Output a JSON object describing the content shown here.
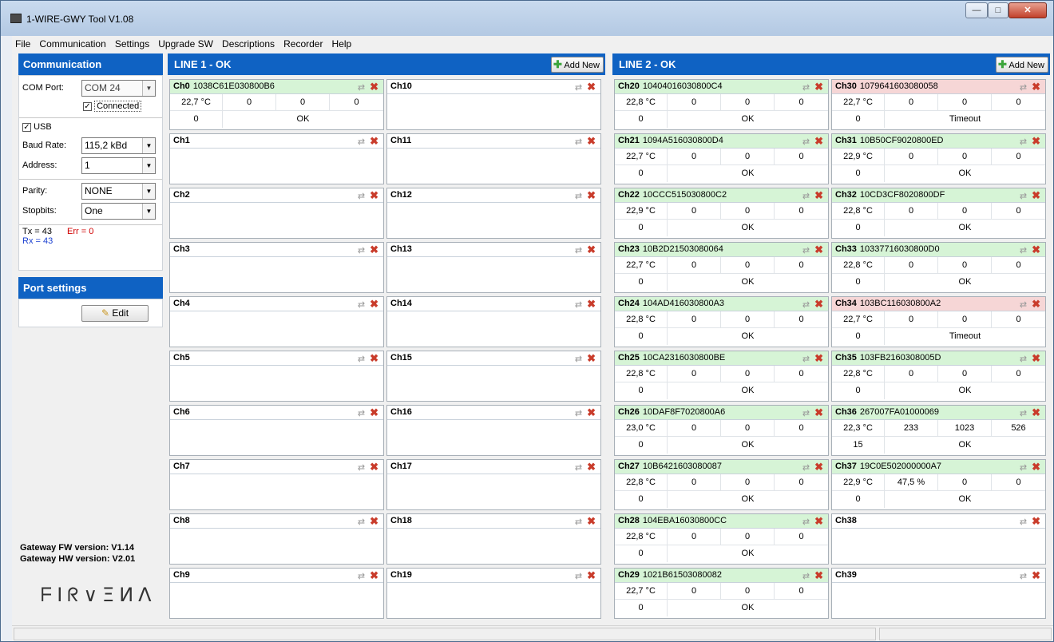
{
  "app": {
    "title": "1-WIRE-GWY Tool V1.08"
  },
  "menu": [
    "File",
    "Communication",
    "Settings",
    "Upgrade SW",
    "Descriptions",
    "Recorder",
    "Help"
  ],
  "communication": {
    "header": "Communication",
    "com_port_label": "COM Port:",
    "com_port_value": "COM 24",
    "connected_label": "Connected",
    "connected_checked": true,
    "usb_label": "USB",
    "usb_checked": true,
    "baud_label": "Baud Rate:",
    "baud_value": "115,2 kBd",
    "address_label": "Address:",
    "address_value": "1",
    "parity_label": "Parity:",
    "parity_value": "NONE",
    "stopbits_label": "Stopbits:",
    "stopbits_value": "One",
    "tx": "Tx = 43",
    "rx": "Rx = 43",
    "err": "Err = 0"
  },
  "port_settings": {
    "header": "Port settings",
    "edit_label": "Edit"
  },
  "gateway": {
    "fw": "Gateway FW version: V1.14",
    "hw": "Gateway HW version: V2.01"
  },
  "logo_text": "FIRVENA",
  "lines": [
    {
      "title": "LINE 1 - OK",
      "add_new": "Add New",
      "channels": [
        {
          "name": "Ch0",
          "addr": "1038C61E030800B6",
          "state": "ok",
          "temp": "22,7 °C",
          "v1": "0",
          "v2": "0",
          "v3": "0",
          "v4": "0",
          "status": "OK"
        },
        {
          "name": "Ch1",
          "addr": "",
          "state": "empty"
        },
        {
          "name": "Ch2",
          "addr": "",
          "state": "empty"
        },
        {
          "name": "Ch3",
          "addr": "",
          "state": "empty"
        },
        {
          "name": "Ch4",
          "addr": "",
          "state": "empty"
        },
        {
          "name": "Ch5",
          "addr": "",
          "state": "empty"
        },
        {
          "name": "Ch6",
          "addr": "",
          "state": "empty"
        },
        {
          "name": "Ch7",
          "addr": "",
          "state": "empty"
        },
        {
          "name": "Ch8",
          "addr": "",
          "state": "empty"
        },
        {
          "name": "Ch9",
          "addr": "",
          "state": "empty"
        },
        {
          "name": "Ch10",
          "addr": "",
          "state": "empty"
        },
        {
          "name": "Ch11",
          "addr": "",
          "state": "empty"
        },
        {
          "name": "Ch12",
          "addr": "",
          "state": "empty"
        },
        {
          "name": "Ch13",
          "addr": "",
          "state": "empty"
        },
        {
          "name": "Ch14",
          "addr": "",
          "state": "empty"
        },
        {
          "name": "Ch15",
          "addr": "",
          "state": "empty"
        },
        {
          "name": "Ch16",
          "addr": "",
          "state": "empty"
        },
        {
          "name": "Ch17",
          "addr": "",
          "state": "empty"
        },
        {
          "name": "Ch18",
          "addr": "",
          "state": "empty"
        },
        {
          "name": "Ch19",
          "addr": "",
          "state": "empty"
        }
      ]
    },
    {
      "title": "LINE 2 - OK",
      "add_new": "Add New",
      "channels": [
        {
          "name": "Ch20",
          "addr": "10404016030800C4",
          "state": "ok",
          "temp": "22,8 °C",
          "v1": "0",
          "v2": "0",
          "v3": "0",
          "v4": "0",
          "status": "OK"
        },
        {
          "name": "Ch21",
          "addr": "1094A516030800D4",
          "state": "ok",
          "temp": "22,7 °C",
          "v1": "0",
          "v2": "0",
          "v3": "0",
          "v4": "0",
          "status": "OK"
        },
        {
          "name": "Ch22",
          "addr": "10CCC515030800C2",
          "state": "ok",
          "temp": "22,9 °C",
          "v1": "0",
          "v2": "0",
          "v3": "0",
          "v4": "0",
          "status": "OK"
        },
        {
          "name": "Ch23",
          "addr": "10B2D21503080064",
          "state": "ok",
          "temp": "22,7 °C",
          "v1": "0",
          "v2": "0",
          "v3": "0",
          "v4": "0",
          "status": "OK"
        },
        {
          "name": "Ch24",
          "addr": "104AD416030800A3",
          "state": "ok",
          "temp": "22,8 °C",
          "v1": "0",
          "v2": "0",
          "v3": "0",
          "v4": "0",
          "status": "OK"
        },
        {
          "name": "Ch25",
          "addr": "10CA2316030800BE",
          "state": "ok",
          "temp": "22,8 °C",
          "v1": "0",
          "v2": "0",
          "v3": "0",
          "v4": "0",
          "status": "OK"
        },
        {
          "name": "Ch26",
          "addr": "10DAF8F7020800A6",
          "state": "ok",
          "temp": "23,0 °C",
          "v1": "0",
          "v2": "0",
          "v3": "0",
          "v4": "0",
          "status": "OK"
        },
        {
          "name": "Ch27",
          "addr": "10B6421603080087",
          "state": "ok",
          "temp": "22,8 °C",
          "v1": "0",
          "v2": "0",
          "v3": "0",
          "v4": "0",
          "status": "OK"
        },
        {
          "name": "Ch28",
          "addr": "104EBA16030800CC",
          "state": "ok",
          "temp": "22,8 °C",
          "v1": "0",
          "v2": "0",
          "v3": "0",
          "v4": "0",
          "status": "OK"
        },
        {
          "name": "Ch29",
          "addr": "1021B61503080082",
          "state": "ok",
          "temp": "22,7 °C",
          "v1": "0",
          "v2": "0",
          "v3": "0",
          "v4": "0",
          "status": "OK"
        },
        {
          "name": "Ch30",
          "addr": "1079641603080058",
          "state": "err",
          "temp": "22,7 °C",
          "v1": "0",
          "v2": "0",
          "v3": "0",
          "v4": "0",
          "status": "Timeout"
        },
        {
          "name": "Ch31",
          "addr": "10B50CF9020800ED",
          "state": "ok",
          "temp": "22,9 °C",
          "v1": "0",
          "v2": "0",
          "v3": "0",
          "v4": "0",
          "status": "OK"
        },
        {
          "name": "Ch32",
          "addr": "10CD3CF8020800DF",
          "state": "ok",
          "temp": "22,8 °C",
          "v1": "0",
          "v2": "0",
          "v3": "0",
          "v4": "0",
          "status": "OK"
        },
        {
          "name": "Ch33",
          "addr": "10337716030800D0",
          "state": "ok",
          "temp": "22,8 °C",
          "v1": "0",
          "v2": "0",
          "v3": "0",
          "v4": "0",
          "status": "OK"
        },
        {
          "name": "Ch34",
          "addr": "103BC116030800A2",
          "state": "err",
          "temp": "22,7 °C",
          "v1": "0",
          "v2": "0",
          "v3": "0",
          "v4": "0",
          "status": "Timeout"
        },
        {
          "name": "Ch35",
          "addr": "103FB2160308005D",
          "state": "ok",
          "temp": "22,8 °C",
          "v1": "0",
          "v2": "0",
          "v3": "0",
          "v4": "0",
          "status": "OK"
        },
        {
          "name": "Ch36",
          "addr": "267007FA01000069",
          "state": "ok",
          "temp": "22,3 °C",
          "v1": "233",
          "v2": "1023",
          "v3": "526",
          "v4": "15",
          "status": "OK"
        },
        {
          "name": "Ch37",
          "addr": "19C0E502000000A7",
          "state": "ok",
          "temp": "22,9 °C",
          "v1": "47,5 %",
          "v2": "0",
          "v3": "0",
          "v4": "0",
          "status": "OK"
        },
        {
          "name": "Ch38",
          "addr": "",
          "state": "empty"
        },
        {
          "name": "Ch39",
          "addr": "",
          "state": "empty"
        }
      ]
    }
  ],
  "icons": {
    "swap": "swap-arrows-icon",
    "delete": "delete-x-icon",
    "add": "add-plus-icon",
    "edit": "pencil-icon"
  }
}
